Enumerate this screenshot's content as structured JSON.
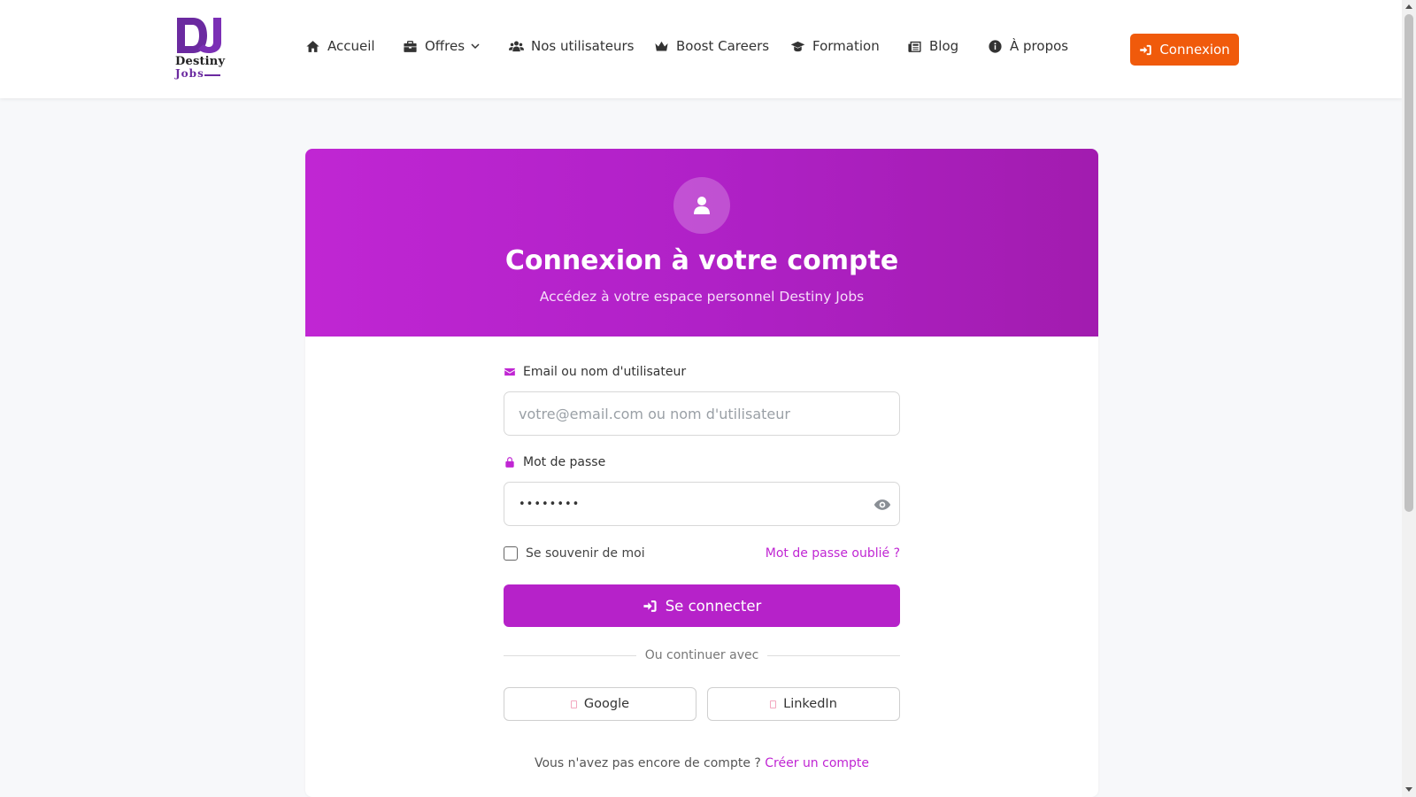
{
  "header": {
    "logo": {
      "line1": "Destiny",
      "line2": "Jobs"
    },
    "nav": [
      {
        "label": "Accueil",
        "icon": "home-icon"
      },
      {
        "label": "Offres",
        "icon": "briefcase-icon",
        "dropdown": true
      },
      {
        "label": "Nos utilisateurs",
        "icon": "users-icon"
      },
      {
        "label": "Boost Careers",
        "icon": "crown-icon"
      },
      {
        "label": "Formation",
        "icon": "graduation-cap-icon"
      },
      {
        "label": "Blog",
        "icon": "newspaper-icon"
      },
      {
        "label": "À propos",
        "icon": "info-circle-icon"
      }
    ],
    "login_button": "Connexion"
  },
  "card": {
    "title": "Connexion à votre compte",
    "subtitle": "Accédez à votre espace personnel Destiny Jobs",
    "email_label": "Email ou nom d'utilisateur",
    "email_placeholder": "votre@email.com ou nom d'utilisateur",
    "email_value": "",
    "password_label": "Mot de passe",
    "password_value": "••••••••",
    "remember_label": "Se souvenir de moi",
    "forgot_link": "Mot de passe oublié ?",
    "submit_label": "Se connecter",
    "divider_text": "Ou continuer avec",
    "social": [
      "Google",
      "LinkedIn"
    ],
    "signup_text": "Vous n'avez pas encore de compte ?",
    "signup_link": "Créer un compte"
  },
  "colors": {
    "primary": "#c026d3",
    "accent": "#f05a0b",
    "header_gradient_start": "#c026d3",
    "header_gradient_end": "#a21caf"
  }
}
